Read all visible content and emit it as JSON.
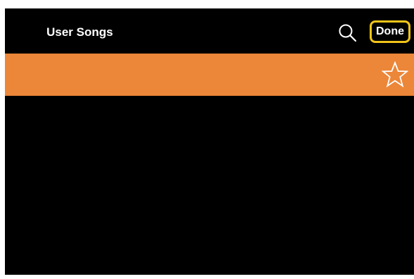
{
  "header": {
    "title": "User Songs",
    "search_icon": "search-icon",
    "done_label": "Done"
  },
  "songs": [
    {
      "name": "",
      "selected": true,
      "favorite_icon": "star-outline-icon",
      "favorite": false
    }
  ],
  "colors": {
    "background": "#000000",
    "selected_row": "#ec8638",
    "highlight_outline": "#f2c418",
    "text": "#ffffff"
  }
}
